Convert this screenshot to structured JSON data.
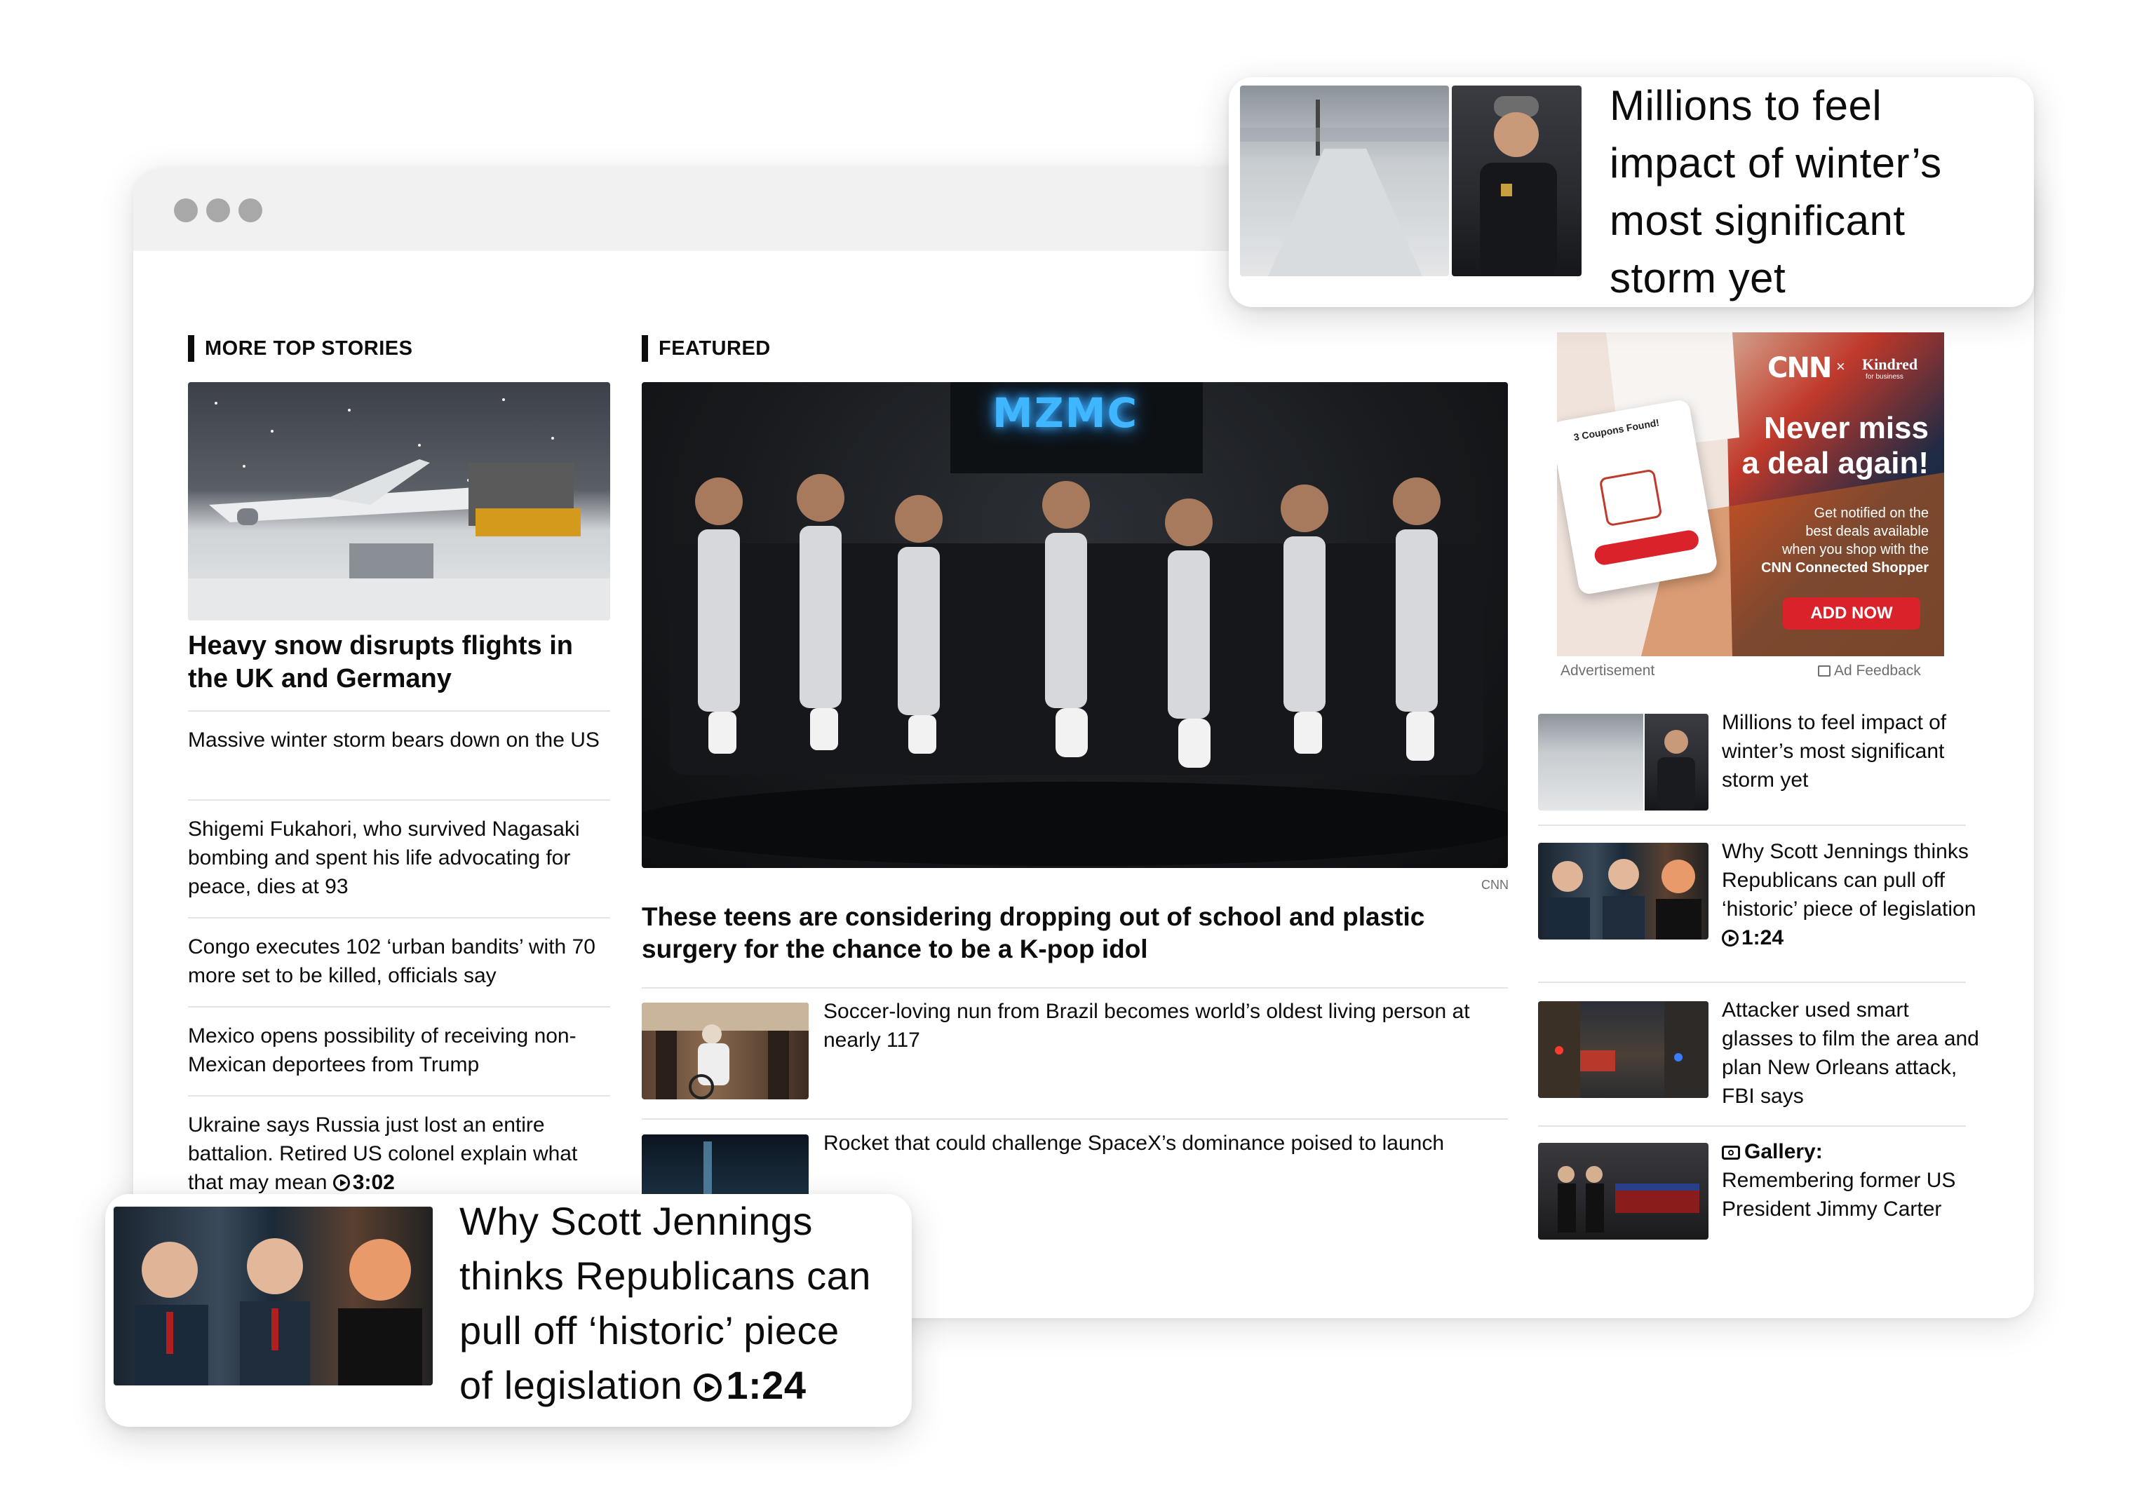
{
  "left_column": {
    "section_label": "MORE TOP STORIES",
    "lead_headline": "Heavy snow disrupts flights in the UK and Germany",
    "items": [
      {
        "text": "Massive winter storm bears down on the US"
      },
      {
        "text": "Shigemi Fukahori, who survived Nagasaki bombing and spent his life advocating for peace, dies at 93"
      },
      {
        "text": "Congo executes 102 ‘urban bandits’ with 70 more set to be killed, officials say"
      },
      {
        "text": "Mexico opens possibility of receiving non-Mexican deportees from Trump"
      },
      {
        "text": "Ukraine says Russia just lost an entire battalion. Retired US colonel explain what that may mean",
        "duration": "3:02"
      }
    ]
  },
  "featured": {
    "section_label": "FEATURED",
    "image_neon_text": "MZMC",
    "image_credit": "CNN",
    "headline": "These teens are considering dropping out of school and plastic surgery for the chance to be a K-pop idol",
    "items": [
      {
        "text": "Soccer-loving nun from Brazil becomes world’s oldest living person at nearly 117"
      },
      {
        "text": "Rocket that could challenge SpaceX’s dominance poised to launch"
      }
    ]
  },
  "ad": {
    "brand": "CNN",
    "partner": "Kindred",
    "partner_sub": "for business",
    "title_line1": "Never miss",
    "title_line2": "a deal again!",
    "body_lines": [
      "Get notified on the",
      "best deals available",
      "when you shop with the"
    ],
    "body_bold": "CNN Connected Shopper",
    "cta": "ADD NOW",
    "popup_title": "3 Coupons Found!",
    "advertisement_label": "Advertisement",
    "feedback_label": "Ad Feedback"
  },
  "right_column": {
    "items": [
      {
        "text": "Millions to feel impact of winter’s most significant storm yet"
      },
      {
        "text": "Why Scott Jennings thinks Republicans can pull off ‘historic’ piece of legislation",
        "duration": "1:24"
      },
      {
        "text": "Attacker used smart glasses to film the area and plan New Orleans attack, FBI says"
      },
      {
        "prefix": "Gallery:",
        "text": "Remembering former US President Jimmy Carter"
      }
    ]
  },
  "callout_top": {
    "lines": [
      "Millions to feel",
      "impact of winter’s",
      "most significant",
      "storm yet"
    ]
  },
  "callout_bottom": {
    "lines": [
      "Why Scott Jennings",
      "thinks Republicans can",
      "pull off ‘historic’ piece",
      "of legislation"
    ],
    "duration": "1:24"
  },
  "colors": {
    "ad_cta": "#d9222a",
    "browser_bar": "#f1f1f1",
    "window_dot": "#a8a8a8",
    "neon": "#3fb6ff"
  }
}
